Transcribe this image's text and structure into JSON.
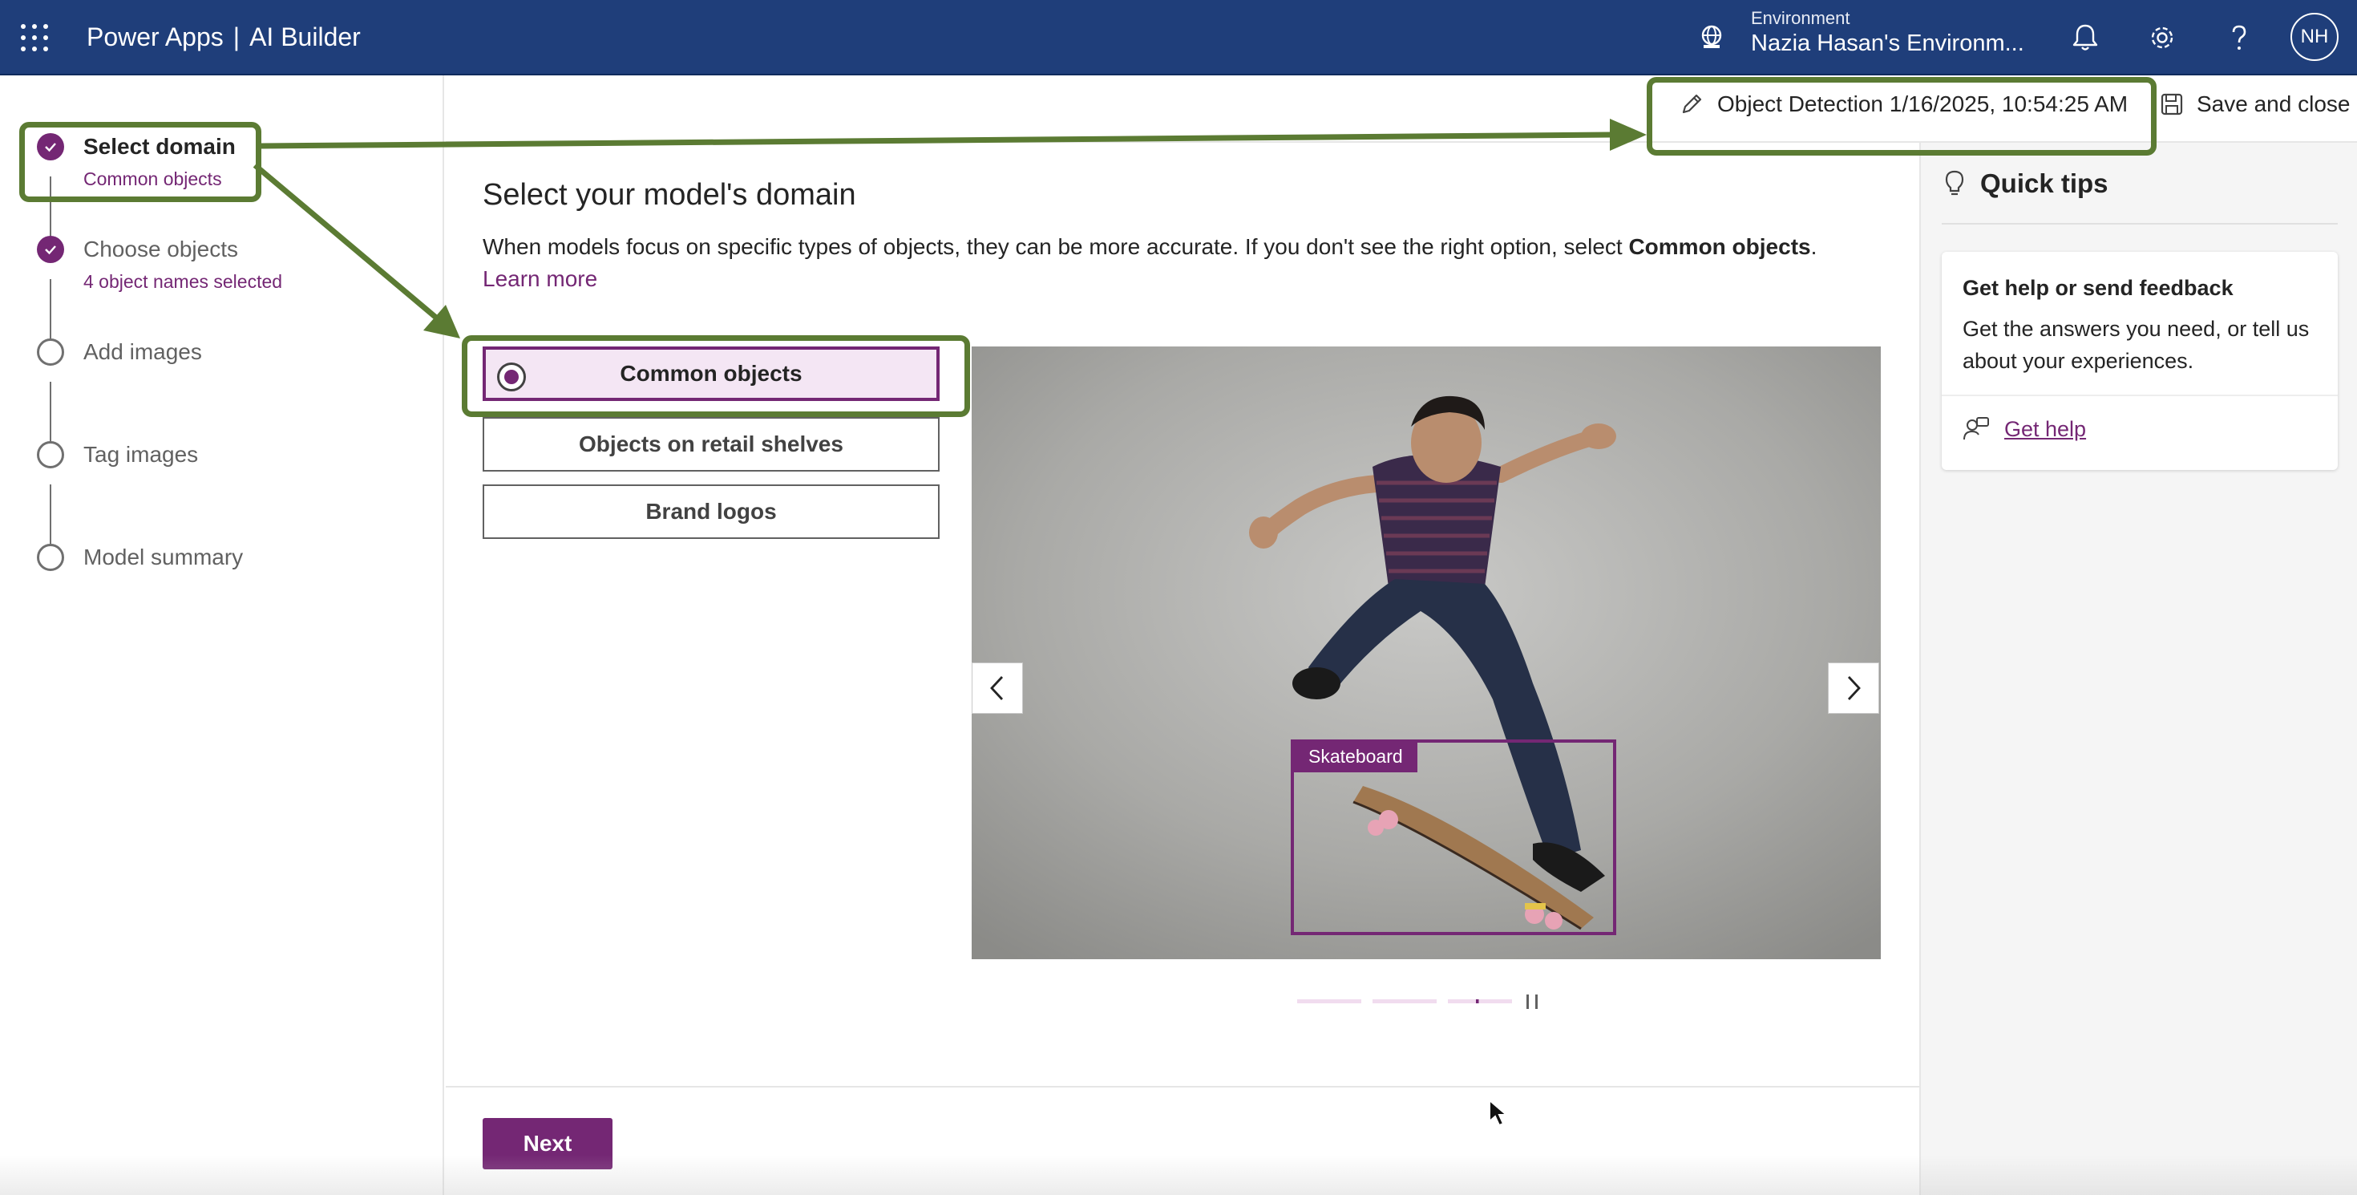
{
  "topbar": {
    "app_name": "Power Apps",
    "separator": "|",
    "product": "AI Builder",
    "environment_label": "Environment",
    "environment_name": "Nazia Hasan's Environm...",
    "avatar_initials": "NH"
  },
  "stepper": {
    "steps": [
      {
        "label": "Select domain",
        "sub": "Common objects",
        "state": "done",
        "active": true
      },
      {
        "label": "Choose objects",
        "sub": "4 object names selected",
        "state": "done",
        "active": false
      },
      {
        "label": "Add images",
        "sub": "",
        "state": "todo",
        "active": false
      },
      {
        "label": "Tag images",
        "sub": "",
        "state": "todo",
        "active": false
      },
      {
        "label": "Model summary",
        "sub": "",
        "state": "todo",
        "active": false
      }
    ]
  },
  "command_bar": {
    "model_name": "Object Detection 1/16/2025, 10:54:25 AM",
    "save_close": "Save and close"
  },
  "main": {
    "title": "Select your model's domain",
    "description_pre": "When models focus on specific types of objects, they can be more accurate. If you don't see the right option, select ",
    "description_bold": "Common objects",
    "description_post": ". ",
    "learn_more": "Learn more",
    "options": [
      {
        "label": "Common objects",
        "selected": true
      },
      {
        "label": "Objects on retail shelves",
        "selected": false
      },
      {
        "label": "Brand logos",
        "selected": false
      }
    ],
    "carousel": {
      "tag_label": "Skateboard",
      "slide_count": 3,
      "active_slide": 2
    },
    "next_button": "Next"
  },
  "quick_tips": {
    "title": "Quick tips",
    "card_title": "Get help or send feedback",
    "card_body": "Get the answers you need, or tell us about your experiences.",
    "link": "Get help"
  },
  "colors": {
    "topbar": "#1f3e7a",
    "accent": "#742774",
    "annotation": "#5b7b33"
  }
}
